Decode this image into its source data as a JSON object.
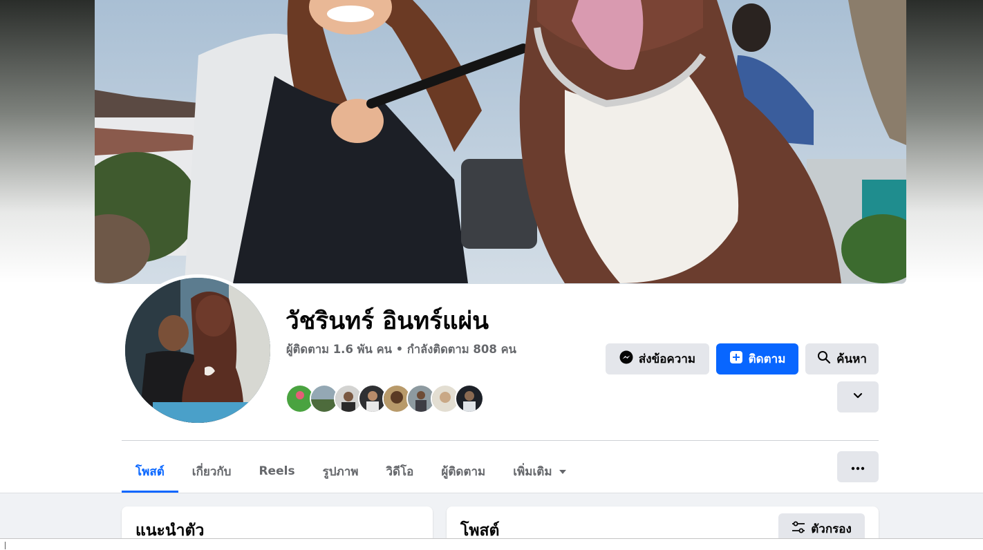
{
  "profile": {
    "name": "วัชรินทร์ อินทร์แผ่น",
    "follow_stats": "ผู้ติดตาม 1.6 พัน คน • กำลังติดตาม 808 คน"
  },
  "actions": {
    "message_label": "ส่งข้อความ",
    "follow_label": "ติดตาม",
    "search_label": "ค้นหา"
  },
  "tabs": [
    {
      "label": "โพสต์",
      "active": true
    },
    {
      "label": "เกี่ยวกับ",
      "active": false
    },
    {
      "label": "Reels",
      "active": false
    },
    {
      "label": "รูปภาพ",
      "active": false
    },
    {
      "label": "วิดีโอ",
      "active": false
    },
    {
      "label": "ผู้ติดตาม",
      "active": false
    },
    {
      "label": "เพิ่มเติม",
      "active": false
    }
  ],
  "intro_card": {
    "title": "แนะนำตัว"
  },
  "posts_card": {
    "title": "โพสต์",
    "filter_label": "ตัวกรอง"
  },
  "colors": {
    "accent": "#0866ff",
    "button_grey": "#e4e6eb",
    "muted_text": "#65676b"
  },
  "icons": [
    "messenger-icon",
    "follow-plus-icon",
    "search-icon",
    "chevron-down-icon",
    "more-dots-icon",
    "filter-icon"
  ]
}
